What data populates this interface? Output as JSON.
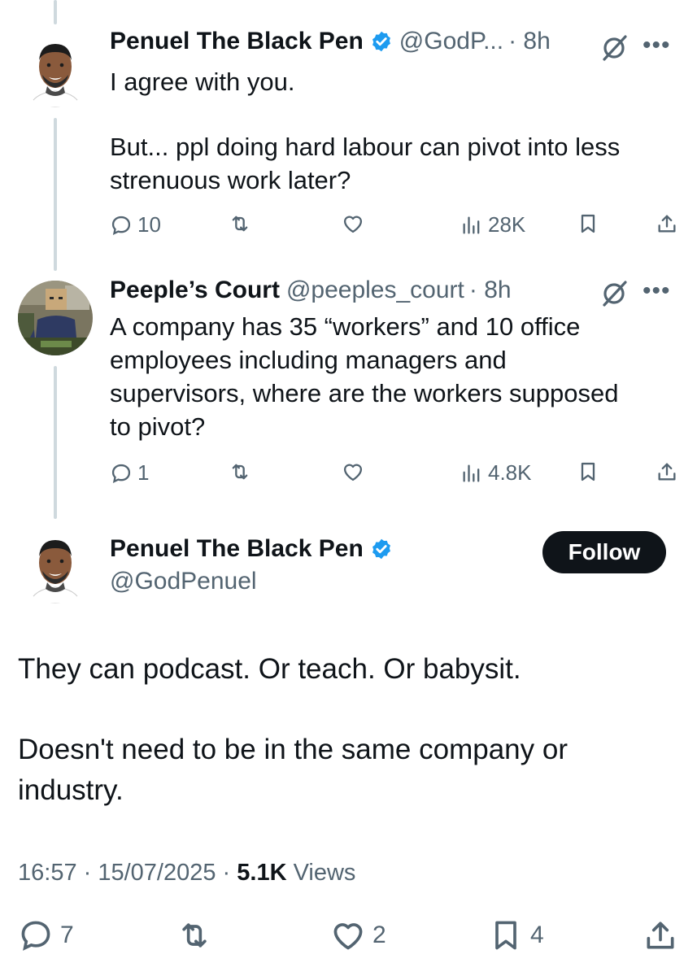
{
  "colors": {
    "text": "#0f1419",
    "secondary": "#536471",
    "verified": "#1d9bf0",
    "thread_line": "#cfd9de",
    "follow_bg": "#0f1419"
  },
  "reply1": {
    "name": "Penuel The Black Pen",
    "handle": "@GodP...",
    "time": "· 8h",
    "line1": "I agree with you.",
    "line2": "But... ppl doing hard labour can pivot into less\nstrenuous work later?",
    "replies": "10",
    "views": "28K"
  },
  "reply2": {
    "name": "Peeple’s Court",
    "handle": "@peeples_court",
    "time": "· 8h",
    "text": "A company has 35 “workers” and 10 office\nemployees including managers and\nsupervisors, where are the workers supposed\nto pivot?",
    "replies": "1",
    "views": "4.8K"
  },
  "main": {
    "name": "Penuel The Black Pen",
    "handle": "@GodPenuel",
    "follow_label": "Follow",
    "line1": "They can podcast. Or teach. Or babysit.",
    "line2": "Doesn't need to be in the same company or",
    "line3": "industry.",
    "timestamp": "16:57 · 15/07/2025 ·",
    "views_count": "5.1K",
    "views_label": "Views",
    "replies": "7",
    "likes": "2",
    "bookmarks": "4"
  },
  "icons": {
    "more": "more-icon",
    "grok": "grok-icon",
    "reply": "reply-icon",
    "retweet": "retweet-icon",
    "like": "heart-icon",
    "views": "views-icon",
    "bookmark": "bookmark-icon",
    "share": "share-icon",
    "verified": "verified-badge-icon"
  }
}
